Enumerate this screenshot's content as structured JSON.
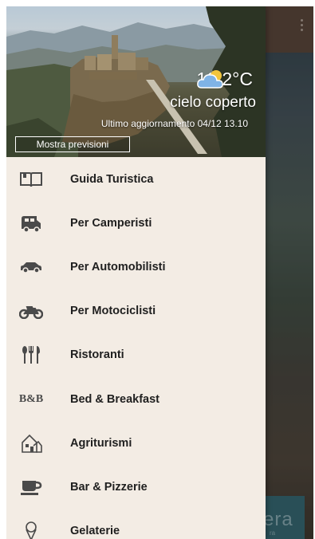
{
  "drawer": {
    "header": {
      "temperature": "10,2°C",
      "weather_icon": "cloud-sun-icon",
      "condition": "cielo coperto",
      "last_update": "Ultimo aggiornamento 04/12 13.10",
      "forecast_button": "Mostra previsioni"
    },
    "menu_items": [
      {
        "label": "Guida Turistica",
        "icon": "book-icon"
      },
      {
        "label": "Per Camperisti",
        "icon": "camper-icon"
      },
      {
        "label": "Per Automobilisti",
        "icon": "car-icon"
      },
      {
        "label": "Per Motociclisti",
        "icon": "motorcycle-icon"
      },
      {
        "label": "Ristoranti",
        "icon": "cutlery-icon"
      },
      {
        "label": "Bed & Breakfast",
        "icon": "bnb-icon"
      },
      {
        "label": "Agriturismi",
        "icon": "farmhouse-icon"
      },
      {
        "label": "Bar & Pizzerie",
        "icon": "coffee-cup-icon"
      },
      {
        "label": "Gelaterie",
        "icon": "ice-cream-icon"
      }
    ],
    "bnb_icon_text": "B&B"
  },
  "background_app": {
    "card_text": "era",
    "card_subtext": "ra",
    "menu_icon": "overflow-menu-icon"
  }
}
